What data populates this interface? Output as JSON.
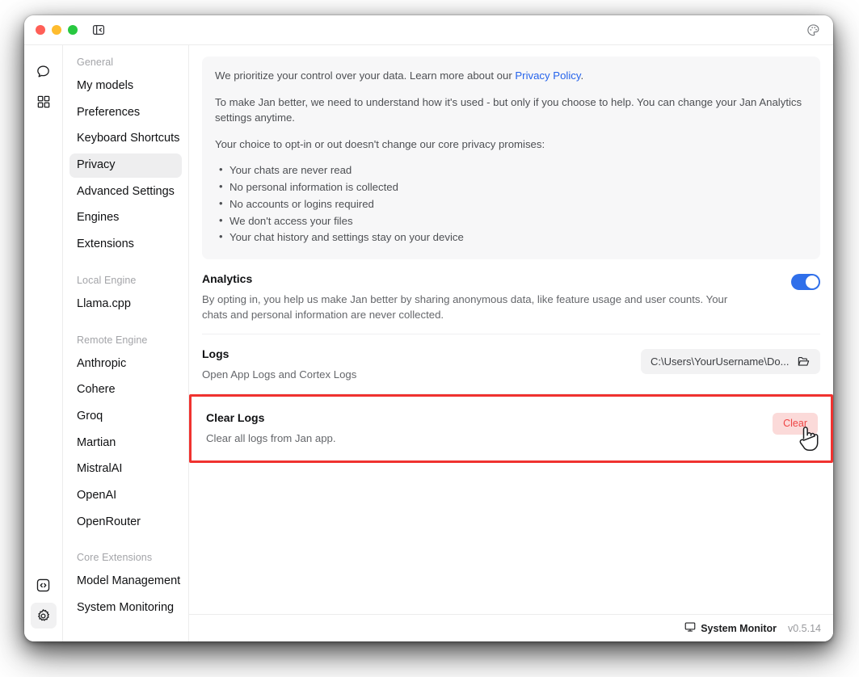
{
  "window": {
    "traffic_lights": [
      "close",
      "minimize",
      "maximize"
    ],
    "sidebar_toggle_icon": "panel-collapse-icon",
    "theme_icon": "palette-icon"
  },
  "icon_rail": {
    "top_items": [
      {
        "name": "chat-icon",
        "label": "Chat",
        "active": false
      },
      {
        "name": "hub-grid-icon",
        "label": "Hub",
        "active": false
      }
    ],
    "bottom_items": [
      {
        "name": "code-icon",
        "label": "Developer",
        "active": false
      },
      {
        "name": "gear-icon",
        "label": "Settings",
        "active": true
      }
    ]
  },
  "sidebar": {
    "groups": [
      {
        "title": "General",
        "items": [
          {
            "label": "My models",
            "active": false
          },
          {
            "label": "Preferences",
            "active": false
          },
          {
            "label": "Keyboard Shortcuts",
            "active": false
          },
          {
            "label": "Privacy",
            "active": true
          },
          {
            "label": "Advanced Settings",
            "active": false
          },
          {
            "label": "Engines",
            "active": false
          },
          {
            "label": "Extensions",
            "active": false
          }
        ]
      },
      {
        "title": "Local Engine",
        "items": [
          {
            "label": "Llama.cpp",
            "active": false
          }
        ]
      },
      {
        "title": "Remote Engine",
        "items": [
          {
            "label": "Anthropic",
            "active": false
          },
          {
            "label": "Cohere",
            "active": false
          },
          {
            "label": "Groq",
            "active": false
          },
          {
            "label": "Martian",
            "active": false
          },
          {
            "label": "MistralAI",
            "active": false
          },
          {
            "label": "OpenAI",
            "active": false
          },
          {
            "label": "OpenRouter",
            "active": false
          }
        ]
      },
      {
        "title": "Core Extensions",
        "items": [
          {
            "label": "Model Management",
            "active": false
          },
          {
            "label": "System Monitoring",
            "active": false
          }
        ]
      }
    ]
  },
  "privacy_info": {
    "paragraph_1_before_link": "We prioritize your control over your data. Learn more about our ",
    "link_text": "Privacy Policy",
    "paragraph_1_after_link": ".",
    "paragraph_2": "To make Jan better, we need to understand how it's used - but only if you choose to help. You can change your Jan Analytics settings anytime.",
    "paragraph_3": "Your choice to opt-in or out doesn't change our core privacy promises:",
    "promises": [
      "Your chats are never read",
      "No personal information is collected",
      "No accounts or logins required",
      "We don't access your files",
      "Your chat history and settings stay on your device"
    ]
  },
  "analytics": {
    "title": "Analytics",
    "description": "By opting in, you help us make Jan better by sharing anonymous data, like feature usage and user counts. Your chats and personal information are never collected.",
    "toggle_on": true,
    "toggle_color": "#2f6fea"
  },
  "logs": {
    "title": "Logs",
    "description": "Open App Logs and Cortex Logs",
    "path_value": "C:\\Users\\YourUsername\\Do...",
    "folder_icon": "open-folder-icon"
  },
  "clear_logs": {
    "title": "Clear Logs",
    "description": "Clear all logs from Jan app.",
    "button_label": "Clear",
    "button_bg": "#fbdad9",
    "button_text_color": "#ef4444",
    "highlight_border_color": "#f0322f",
    "cursor": "pointing-hand-cursor"
  },
  "footer": {
    "system_monitor_label": "System Monitor",
    "system_monitor_icon": "monitor-icon",
    "version": "v0.5.14"
  }
}
